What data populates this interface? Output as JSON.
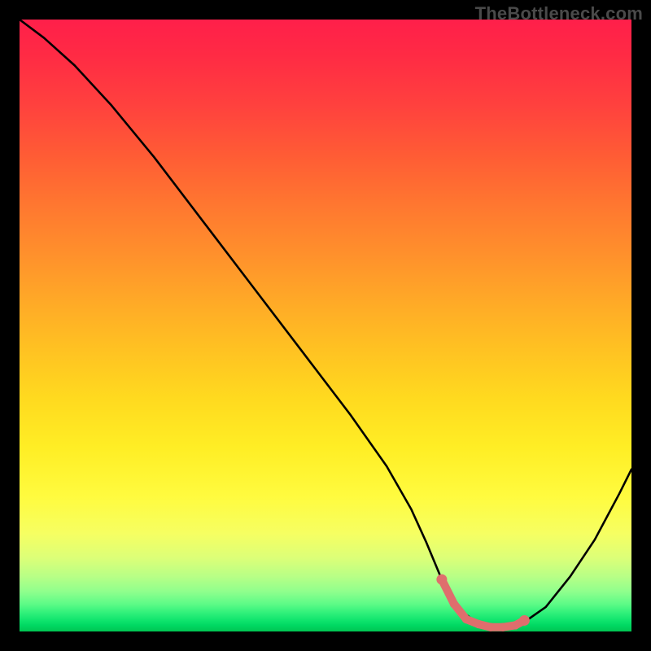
{
  "watermark": "TheBottleneck.com",
  "chart_data": {
    "type": "line",
    "title": "",
    "xlabel": "",
    "ylabel": "",
    "xlim": [
      0,
      100
    ],
    "ylim": [
      0,
      100
    ],
    "series": [
      {
        "name": "bottleneck-curve",
        "x": [
          0,
          4,
          9,
          15,
          22,
          30,
          38,
          46,
          54,
          60,
          64,
          66.5,
          69,
          72,
          75,
          77.5,
          80,
          82,
          86,
          90,
          94,
          98,
          100
        ],
        "y": [
          100,
          97,
          92.5,
          86,
          77.5,
          67,
          56.5,
          46,
          35.5,
          27,
          20,
          14.5,
          8.5,
          3.5,
          1.2,
          0.6,
          0.6,
          1.2,
          4,
          9,
          15,
          22.5,
          26.5
        ]
      }
    ],
    "highlight": {
      "name": "optimal-range",
      "color": "#df6e6d",
      "x": [
        69,
        71,
        73,
        75,
        77,
        79,
        81,
        82.5
      ],
      "y": [
        8.5,
        4.5,
        2.0,
        1.2,
        0.7,
        0.7,
        1.0,
        1.8
      ]
    },
    "colors": {
      "background_top": "#ff1f4a",
      "background_bottom": "#00c552",
      "curve": "#000000",
      "highlight": "#df6e6d",
      "frame": "#000000"
    }
  }
}
